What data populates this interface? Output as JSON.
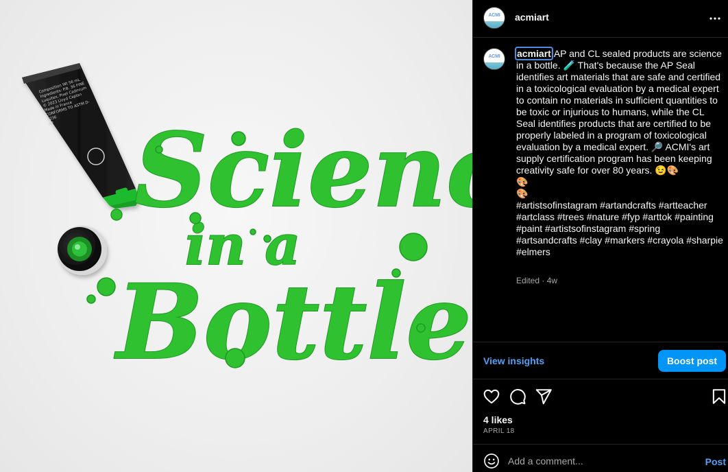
{
  "image": {
    "tube_label": "Composition Wt 56 mL\nIngredients: P.B. 36 FINE\nLuquitex, Pixel Cadmium\n© 2023 Lloyd Caplan\nMade in France\nCONFORMS TO ASTM D-4236\nAP",
    "tube_seal": "AP",
    "art_lines": [
      "Science",
      "in a",
      "Bottle"
    ],
    "paint_color": "#2fc12f"
  },
  "header": {
    "username": "acmiart",
    "avatar_text": "ACMI"
  },
  "caption": {
    "username": "acmiart",
    "text": "AP and CL sealed products are science in a bottle. 🧪 That's because the AP Seal identifies art materials that are safe and certified in a toxicological evaluation by a medical expert to contain no materials in sufficient quantities to be toxic or injurious to humans, while the CL Seal identifies products that are certified to be properly labeled in a program of toxicological evaluation by a medical expert. 🔎 ACMI's art supply certification program has been keeping creativity safe for over 80 years. 😉🎨\n🎨\n🎨\n#artistsofinstagram #artandcrafts #artteacher #artclass #trees #nature #fyp #arttok #painting #paint #artistsofinstagram #spring #artsandcrafts #clay #markers #crayola #sharpie #elmers",
    "meta": "Edited · 4w"
  },
  "insights": {
    "view_label": "View insights",
    "boost_label": "Boost post"
  },
  "actions": {
    "like_icon": "heart-icon",
    "comment_icon": "comment-icon",
    "share_icon": "share-icon",
    "save_icon": "bookmark-icon"
  },
  "stats": {
    "likes": "4 likes",
    "date": "APRIL 18"
  },
  "comment": {
    "placeholder": "Add a comment...",
    "post_label": "Post"
  },
  "colors": {
    "accent": "#0095f6",
    "link": "#4fa3f7",
    "background": "#000000",
    "muted": "#a8a8a8"
  }
}
